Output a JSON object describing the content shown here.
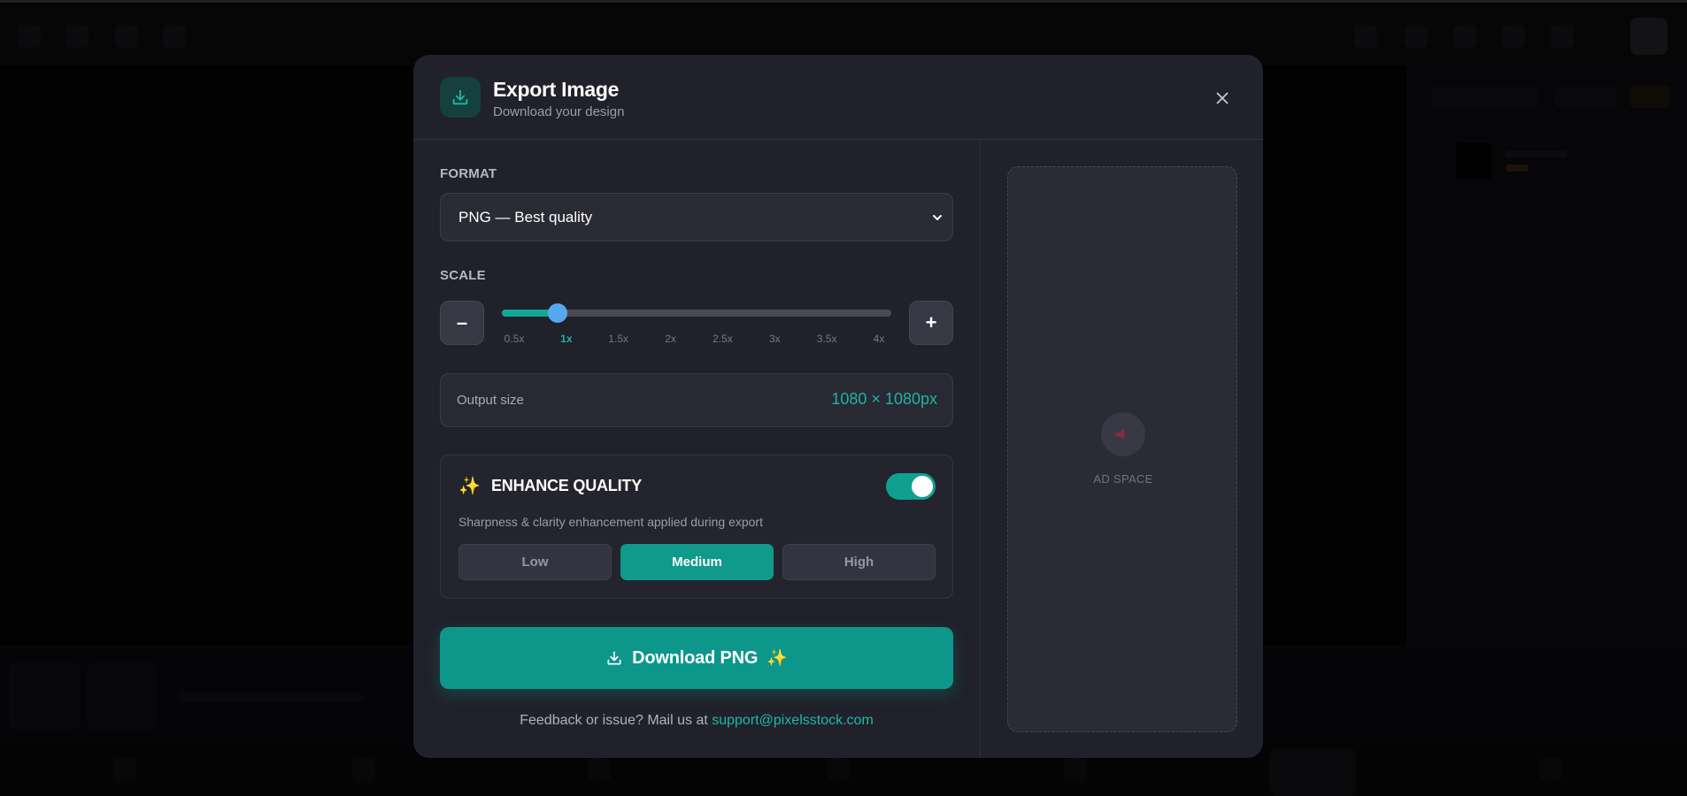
{
  "modal": {
    "title": "Export Image",
    "subtitle": "Download your design",
    "header_icon": "download-icon",
    "close_icon": "close-icon"
  },
  "format": {
    "label": "FORMAT",
    "selected": "PNG — Best quality"
  },
  "scale": {
    "label": "SCALE",
    "minus": "–",
    "plus": "+",
    "value": 1,
    "min": 0.5,
    "max": 4,
    "ticks": [
      "0.5x",
      "1x",
      "1.5x",
      "2x",
      "2.5x",
      "3x",
      "3.5x",
      "4x"
    ],
    "active_tick": "1x"
  },
  "output": {
    "label": "Output size",
    "value": "1080 × 1080px"
  },
  "enhance": {
    "sparkle": "✨",
    "title": "ENHANCE QUALITY",
    "enabled": true,
    "description": "Sharpness & clarity enhancement applied during export",
    "levels": [
      "Low",
      "Medium",
      "High"
    ],
    "selected_level": "Medium"
  },
  "download": {
    "label": "Download PNG",
    "sparkle": "✨",
    "icon": "download-icon"
  },
  "feedback": {
    "text": "Feedback or issue? Mail us at ",
    "email": "support@pixelsstock.com"
  },
  "ad": {
    "label": "AD SPACE",
    "icon": "megaphone-icon"
  },
  "colors": {
    "accent": "#10a090",
    "modal_bg": "#20212a",
    "slider_thumb": "#55a8f0"
  }
}
